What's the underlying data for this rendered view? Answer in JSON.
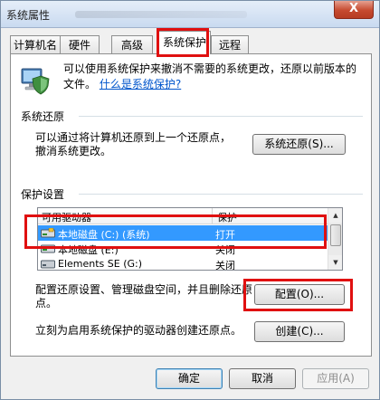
{
  "window": {
    "title": "系统属性",
    "close_label": "X"
  },
  "tabs": [
    {
      "label": "计算机名"
    },
    {
      "label": "硬件"
    },
    {
      "label": "高级"
    },
    {
      "label": "系统保护"
    },
    {
      "label": "远程"
    }
  ],
  "intro": {
    "text": "可以使用系统保护来撤消不需要的系统更改，还原以前版本的文件。",
    "link": "什么是系统保护?"
  },
  "restore": {
    "title": "系统还原",
    "desc_line1": "可以通过将计算机还原到上一个还原点，",
    "desc_line2": "撤消系统更改。",
    "button": "系统还原(S)..."
  },
  "protection": {
    "title": "保护设置",
    "columns": [
      "可用驱动器",
      "保护"
    ],
    "drives": [
      {
        "name": "本地磁盘 (C:) (系统)",
        "status": "打开",
        "icon": "hard-drive-system-icon",
        "selected": true
      },
      {
        "name": "本地磁盘 (E:)",
        "status": "关闭",
        "icon": "hard-drive-icon",
        "selected": false
      },
      {
        "name": "Elements SE (G:)",
        "status": "关闭",
        "icon": "external-drive-icon",
        "selected": false
      }
    ]
  },
  "configure": {
    "text_line1": "配置还原设置、管理磁盘空间，并且删除还原",
    "text_line2": "点。",
    "button": "配置(O)..."
  },
  "create": {
    "text": "立刻为启用系统保护的驱动器创建还原点。",
    "button": "创建(C)..."
  },
  "footer": {
    "ok": "确定",
    "cancel": "取消",
    "apply": "应用(A)"
  },
  "colors": {
    "selection": "#3399ff",
    "highlight_box": "#e01010",
    "link": "#0055cc"
  }
}
